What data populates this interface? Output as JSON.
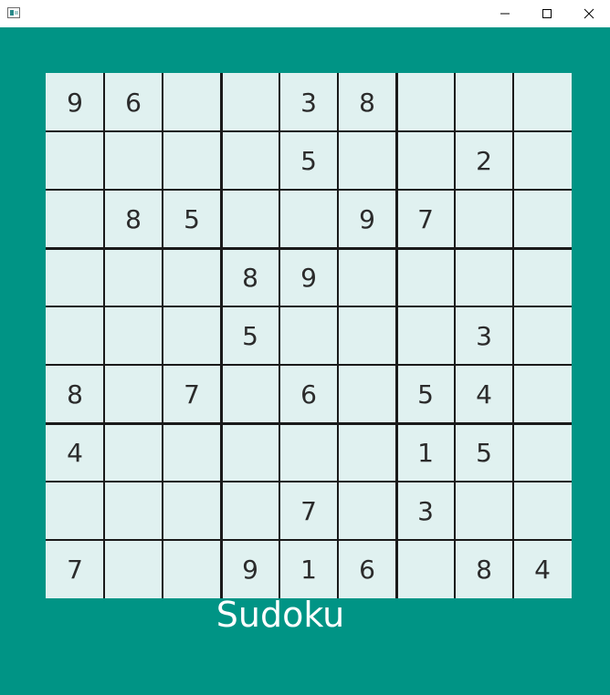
{
  "window": {
    "controls": {
      "minimize_icon": "minimize-icon",
      "maximize_icon": "maximize-icon",
      "close_icon": "close-icon"
    }
  },
  "colors": {
    "background": "#009485",
    "board": "#e0f1f0",
    "digit": "#2b2b2b",
    "title": "#ffffff"
  },
  "board": {
    "rows": [
      [
        "9",
        "6",
        "",
        "",
        "3",
        "8",
        "",
        "",
        ""
      ],
      [
        "",
        "",
        "",
        "",
        "5",
        "",
        "",
        "2",
        ""
      ],
      [
        "",
        "8",
        "5",
        "",
        "",
        "9",
        "7",
        "",
        ""
      ],
      [
        "",
        "",
        "",
        "8",
        "9",
        "",
        "",
        "",
        ""
      ],
      [
        "",
        "",
        "",
        "5",
        "",
        "",
        "",
        "3",
        ""
      ],
      [
        "8",
        "",
        "7",
        "",
        "6",
        "",
        "5",
        "4",
        ""
      ],
      [
        "4",
        "",
        "",
        "",
        "",
        "",
        "1",
        "5",
        ""
      ],
      [
        "",
        "",
        "",
        "",
        "7",
        "",
        "3",
        "",
        ""
      ],
      [
        "7",
        "",
        "",
        "9",
        "1",
        "6",
        "",
        "8",
        "4"
      ]
    ]
  },
  "footer": {
    "title": "Sudoku"
  }
}
